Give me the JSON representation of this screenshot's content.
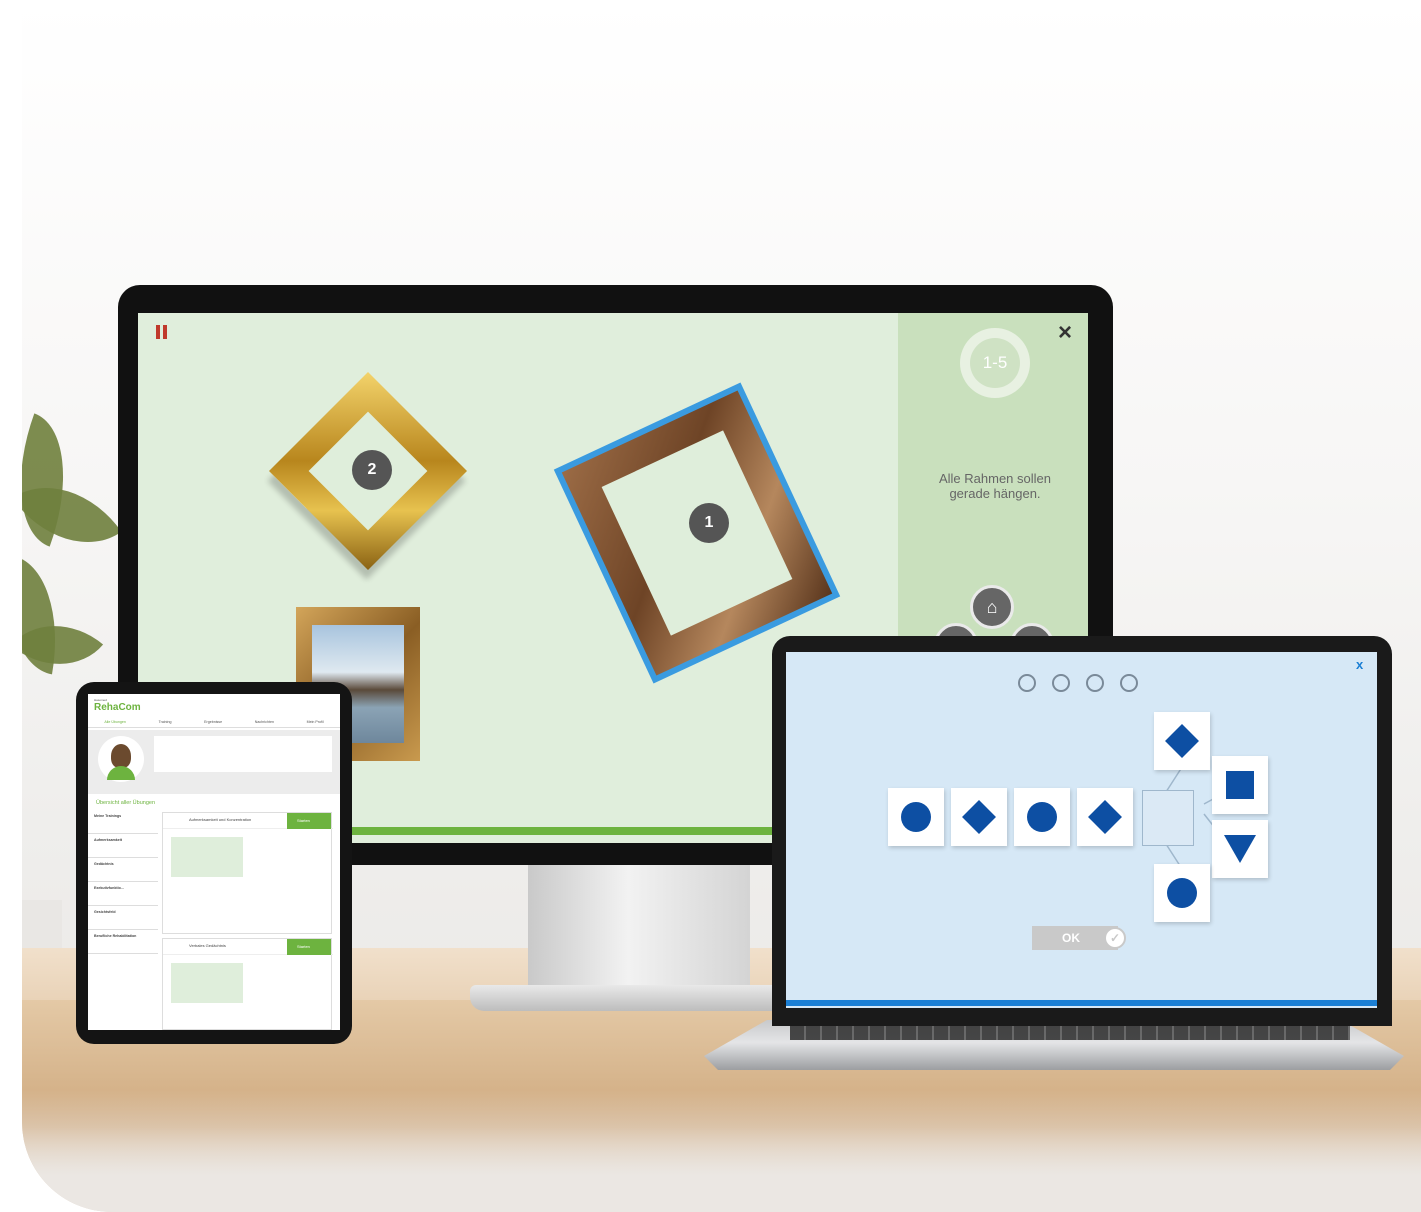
{
  "monitor_game": {
    "frames": [
      {
        "badge": "2"
      },
      {
        "badge": "1"
      }
    ],
    "level_label": "1-5",
    "instruction": "Alle Rahmen sollen gerade hängen.",
    "close_icon": "×"
  },
  "laptop_game": {
    "progress_dots": 4,
    "sequence_shapes": [
      "circle",
      "diamond",
      "circle",
      "diamond"
    ],
    "option_shapes": [
      "diamond",
      "square",
      "triangle",
      "circle"
    ],
    "ok_label": "OK",
    "close_icon": "x",
    "accent_color": "#0d4fa3"
  },
  "tablet_app": {
    "brand_small": "Hasomed",
    "brand": "RehaCom",
    "nav": [
      "Alle Übungen",
      "Training",
      "Ergebnisse",
      "Nachrichten",
      "Mein Profil"
    ],
    "section_title": "Übersicht aller Übungen",
    "sidebar": [
      "Meine Trainings",
      "Aufmerksamkeit",
      "Gedächtnis",
      "Exekutivfunktio...",
      "Gesichtsfeld",
      "Berufliche Rehabilitation"
    ],
    "cards": [
      {
        "title": "Aufmerksamkeit und Konzentration",
        "start": "Starten"
      },
      {
        "title": "Verbales Gedächtnis",
        "start": "Starten"
      }
    ],
    "accent_color": "#6db33f"
  }
}
